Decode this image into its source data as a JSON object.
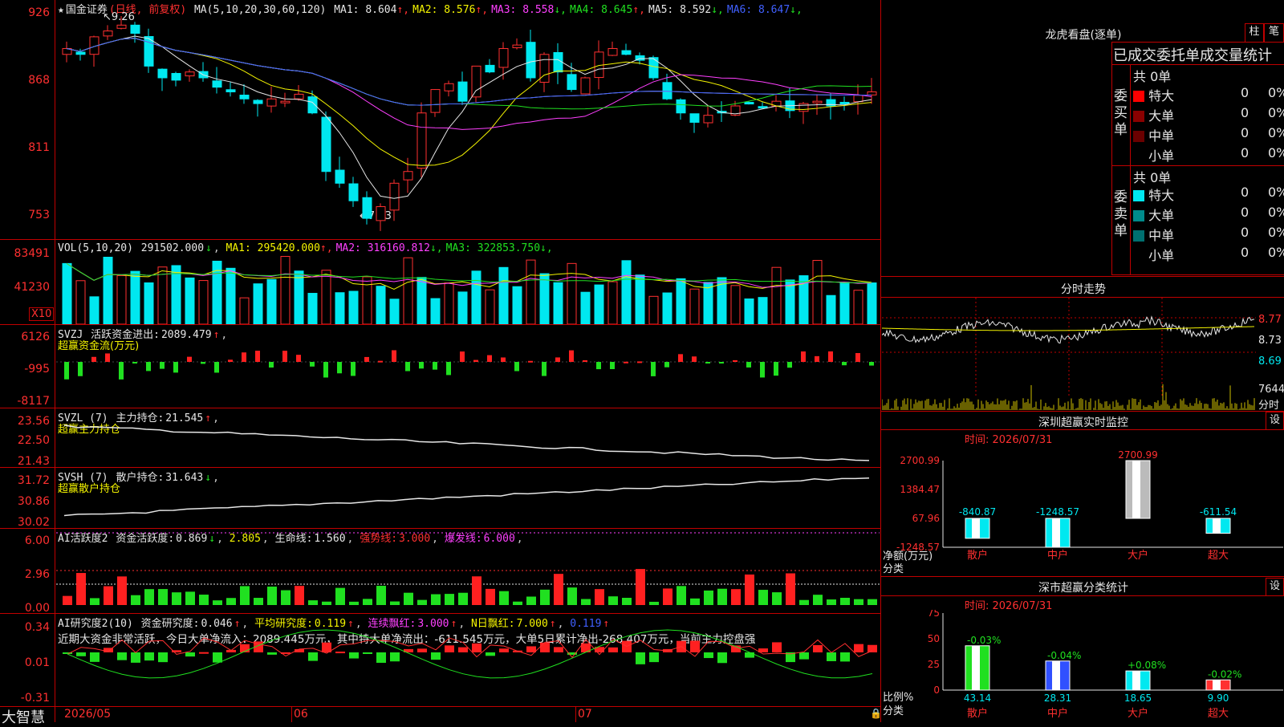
{
  "stock": {
    "name": "国金证券",
    "period": "(日线, 前复权)",
    "ma_label": "MA(5,10,20,30,60,120)",
    "ma": [
      {
        "label": "MA1:",
        "value": "8.604",
        "arrow": "↑",
        "color": "#e6e6e6"
      },
      {
        "label": "MA2:",
        "value": "8.576",
        "arrow": "↑",
        "color": "#f4f400"
      },
      {
        "label": "MA3:",
        "value": "8.558",
        "arrow": "↓",
        "color": "#ff40ff"
      },
      {
        "label": "MA4:",
        "value": "8.645",
        "arrow": "↑",
        "color": "#20e020"
      },
      {
        "label": "MA5:",
        "value": "8.592",
        "arrow": "↓",
        "color": "#e6e6e6"
      },
      {
        "label": "MA6:",
        "value": "8.647",
        "arrow": "↓",
        "color": "#4060ff"
      }
    ],
    "high_mark": "9.26",
    "low_mark": "7.53",
    "price_axis": [
      "926",
      "868",
      "811",
      "753"
    ]
  },
  "volume": {
    "label": "VOL(5,10,20)",
    "value": "291502.000",
    "value_arrow": "↓",
    "ma": [
      {
        "label": "MA1:",
        "value": "295420.000",
        "arrow": "↑",
        "color": "#f4f400"
      },
      {
        "label": "MA2:",
        "value": "316160.812",
        "arrow": "↓",
        "color": "#ff40ff"
      },
      {
        "label": "MA3:",
        "value": "322853.750",
        "arrow": "↓",
        "color": "#20e020"
      }
    ],
    "axis": [
      "83491",
      "41230"
    ],
    "unit": "X10"
  },
  "svzj": {
    "label": "SVZJ",
    "name": "活跃资金进出:",
    "value": "2089.479",
    "arrow": "↑",
    "subtitle": "超赢资金流(万元)",
    "axis": [
      "6126",
      "-995",
      "-8117"
    ]
  },
  "svzl": {
    "label": "SVZL (7)",
    "name": "主力持仓:",
    "value": "21.545",
    "arrow": "↑",
    "subtitle": "超赢主力持仓",
    "axis": [
      "23.56",
      "22.50",
      "21.43"
    ]
  },
  "svsh": {
    "label": "SVSH (7)",
    "name": "散户持仓:",
    "value": "31.643",
    "arrow": "↓",
    "subtitle": "超赢散户持仓",
    "axis": [
      "31.72",
      "30.86",
      "30.02"
    ]
  },
  "ai_active": {
    "label": "AI活跃度2",
    "name": "资金活跃度:",
    "value1": "0.869",
    "arrow1": "↓",
    "value2": "2.805",
    "life_label": "生命线:",
    "life": "1.560",
    "strong_label": "强势线:",
    "strong": "3.000",
    "burst_label": "爆发线:",
    "burst": "6.000",
    "axis": [
      "6.00",
      "2.96",
      "0.00"
    ]
  },
  "ai_research": {
    "label": "AI研究度2(10)",
    "name": "资金研究度:",
    "value": "0.046",
    "arrow": "↑",
    "avg_label": "平均研究度:",
    "avg": "0.119",
    "avg_arrow": "↑",
    "red_label": "连续飘红:",
    "red": "3.000",
    "red_arrow": "↑",
    "nday_label": "N日飘红:",
    "nday": "7.000",
    "nday_arrow": "↑",
    "last": "0.119",
    "last_arrow": "↑",
    "comment": "近期大资金非常活跃，今日大单净流入：2089.445万元，其中特大单净流出：-611.545万元，大单5日累计净出-268.407万元，当前主力控盘强",
    "axis": [
      "0.34",
      "0.01",
      "-0.31"
    ]
  },
  "footer": {
    "brand": "大智慧",
    "dates": [
      "2026/05",
      "06",
      "07"
    ]
  },
  "dragon": {
    "title": "龙虎看盘(逐单)",
    "btn1": "柱",
    "btn2": "笔",
    "header": "已成交委托单成交量统计",
    "buy_side": "委买单",
    "sell_side": "委卖单",
    "buy_total": "共 0单",
    "sell_total": "共 0单",
    "buy_rows": [
      {
        "name": "特大",
        "val": "0",
        "pct": "0%",
        "color": "#ff0000"
      },
      {
        "name": "大单",
        "val": "0",
        "pct": "0%",
        "color": "#8a0000"
      },
      {
        "name": "中单",
        "val": "0",
        "pct": "0%",
        "color": "#6a0000"
      },
      {
        "name": "小单",
        "val": "0",
        "pct": "0%",
        "color": "#000000"
      }
    ],
    "sell_rows": [
      {
        "name": "特大",
        "val": "0",
        "pct": "0%",
        "color": "#00e8f0"
      },
      {
        "name": "大单",
        "val": "0",
        "pct": "0%",
        "color": "#008a8a"
      },
      {
        "name": "中单",
        "val": "0",
        "pct": "0%",
        "color": "#007070"
      },
      {
        "name": "小单",
        "val": "0",
        "pct": "0%",
        "color": "#000000"
      }
    ]
  },
  "intraday": {
    "title": "分时走势",
    "axis": [
      "8.77",
      "8.73",
      "8.69"
    ],
    "vol_label": "7644",
    "footer": "分时"
  },
  "sz_monitor": {
    "title": "深圳超赢实时监控",
    "btn": "设",
    "time": "时间: 2026/07/31",
    "axis": [
      "2700.99",
      "1384.47",
      "67.96",
      "-1248.57"
    ],
    "ylabel": "净额(万元)",
    "xlabel": "分类",
    "categories": [
      "散户",
      "中户",
      "大户",
      "超大"
    ],
    "values": [
      -840.87,
      -1248.57,
      2700.99,
      -611.54
    ],
    "value_labels": [
      "-840.87",
      "-1248.57",
      "2700.99",
      "-611.54"
    ]
  },
  "sz_stats": {
    "title": "深市超赢分类统计",
    "btn": "设",
    "time": "时间: 2026/07/31",
    "axis": [
      "75",
      "50",
      "25",
      "0"
    ],
    "ylabel": "比例%",
    "xlabel": "分类",
    "categories": [
      "散户",
      "中户",
      "大户",
      "超大"
    ],
    "values": [
      43.14,
      28.31,
      18.65,
      9.9
    ],
    "value_labels": [
      "43.14",
      "28.31",
      "18.65",
      "9.90"
    ],
    "changes": [
      "-0.03%",
      "-0.04%",
      "+0.08%",
      "-0.02%"
    ]
  },
  "chart_data": [
    {
      "type": "bar",
      "title": "深圳超赢实时监控",
      "ylabel": "净额(万元)",
      "xlabel": "分类",
      "categories": [
        "散户",
        "中户",
        "大户",
        "超大"
      ],
      "values": [
        -840.87,
        -1248.57,
        2700.99,
        -611.54
      ],
      "ylim": [
        -1248.57,
        2700.99
      ]
    },
    {
      "type": "bar",
      "title": "深市超赢分类统计",
      "ylabel": "比例%",
      "xlabel": "分类",
      "categories": [
        "散户",
        "中户",
        "大户",
        "超大"
      ],
      "values": [
        43.14,
        28.31,
        18.65,
        9.9
      ],
      "ylim": [
        0,
        75
      ]
    }
  ]
}
